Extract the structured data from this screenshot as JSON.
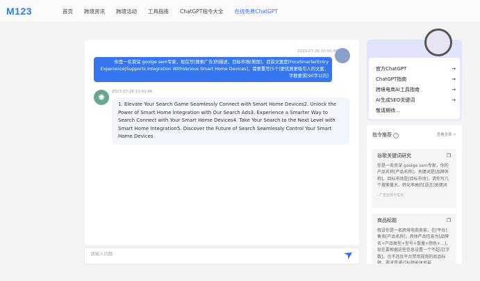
{
  "header": {
    "logo": "M123",
    "nav": [
      "首页",
      "跨境资讯",
      "跨境活动",
      "工具指南",
      "ChatGPT指令大全",
      "在线免费ChatGPT"
    ]
  },
  "chat": {
    "user": {
      "time": "2023-07-26 10:50:46",
      "text": "你是一名资深 goolge sem专家，现在写[搜索广告]的描述，目标市场[美国]，目前文案是[ForaSmarterEntry Experience|Supports Integration WithVarious Smart Home Devices]，需要重写[5个]更优质更吸引人的文案，字数要求[90字以内]"
    },
    "bot": {
      "time": "2023-07-26 10:50:46",
      "text": "1. Elevate Your Search Game Seamlessly Connect with Smart Home Devices2. Unlock the Power of Smart Home Integration with Our Search Ads3. Experience a Smarter Way to Search Connect with Your Smart Home Devices4. Take Your Search to the Next Level with Smart Home Integration5. Discover the Future of Search Seamlessly Control Your Smart Home Devices"
    },
    "input_placeholder": "请输入问题"
  },
  "sidebar": {
    "links": [
      {
        "label": "官方ChatGPT",
        "arrow": "→"
      },
      {
        "label": "ChatGPT指南",
        "arrow": "→"
      },
      {
        "label": "跨境电商AI工具指南",
        "arrow": "→"
      },
      {
        "label": "AI生成SEO关键词",
        "arrow": "→"
      },
      {
        "label": "敬请期待...",
        "arrow": ""
      }
    ],
    "prompts_title": "指令推荐",
    "prompts_help": "?",
    "view_all": "查看全部 >",
    "prompts": [
      {
        "title": "谷歌关键词研究",
        "text": "你是一名资深 goolge sem专家，你的产品名称[产品名称]，关键词是[品牌名称]，目标市场是[目标市场]，请你写几个搜索量大、转化率高的[语言]关键词",
        "tag": "· 广告创意与优化"
      },
      {
        "title": "商品标题",
        "text": "假设你是一名跨境电商卖家，在[平台]售卖[产品名称]，具体产品信息为[品牌名+产品类型+型号+数量+颜色+...]，现在要根据这些信息设置一个不超过[字数]，也不违反平台禁用规则的商品标题，要求是通过标题能体现最",
        "tag": ""
      }
    ]
  }
}
